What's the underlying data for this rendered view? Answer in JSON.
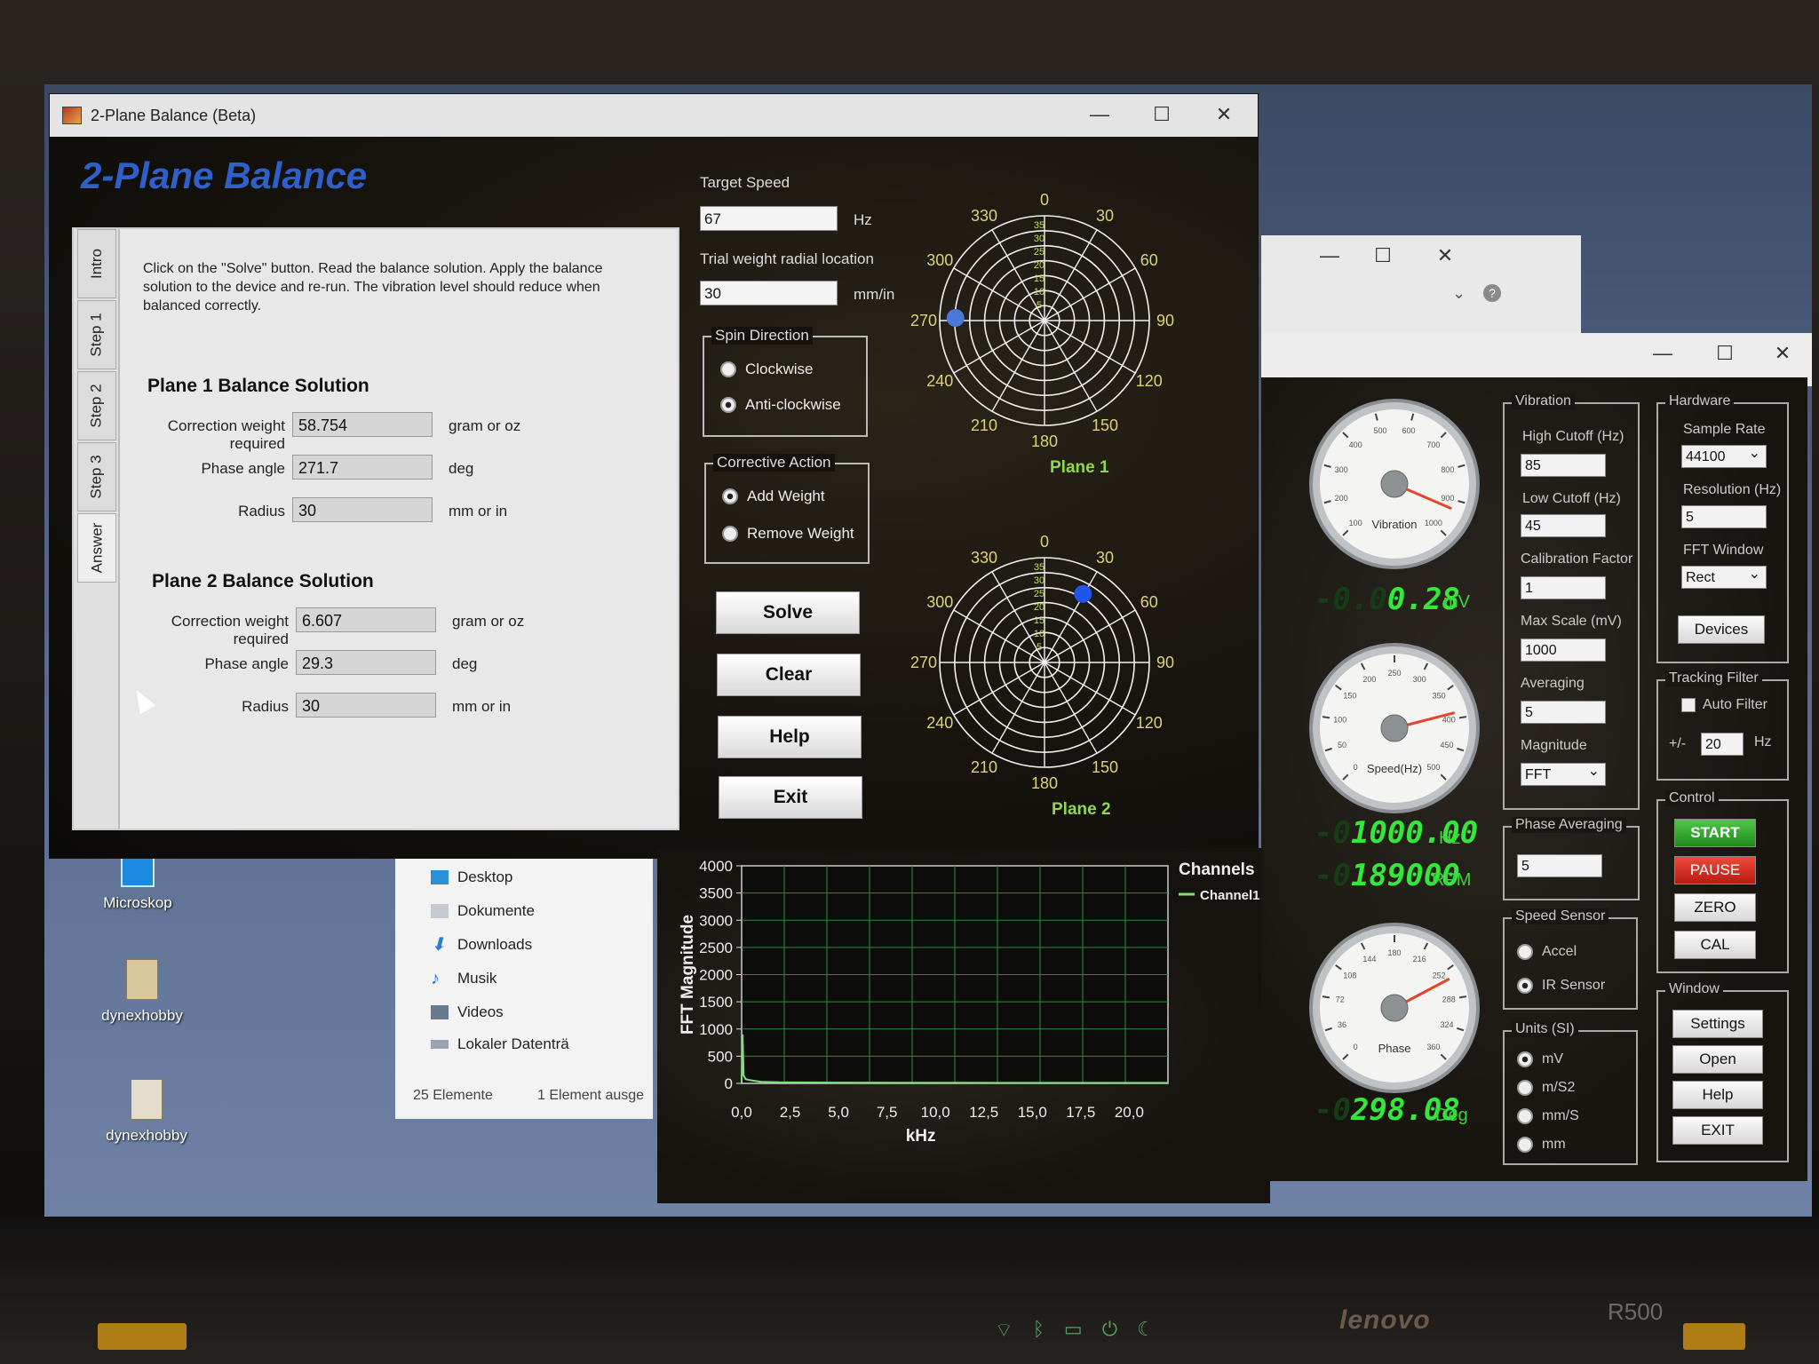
{
  "laptop": {
    "brand": "lenovo",
    "model": "R500"
  },
  "desktop": {
    "icons": [
      "Microskop",
      "dynexhobby",
      "dynexhobby"
    ],
    "explorer": {
      "items": [
        "Desktop",
        "Dokumente",
        "Downloads",
        "Musik",
        "Videos",
        "Lokaler Datenträ"
      ],
      "status_count": "25 Elemente",
      "status_selected": "1 Element ausge"
    }
  },
  "window": {
    "title": "2-Plane Balance (Beta)",
    "app_heading": "2-Plane Balance",
    "controls": [
      "—",
      "☐",
      "✕"
    ]
  },
  "wizard": {
    "tabs": [
      "Intro",
      "Step 1",
      "Step 2",
      "Step 3",
      "Answer"
    ],
    "instructions": "Click on the \"Solve\" button. Read the balance solution. Apply the balance solution to the device and re-run. The vibration level should reduce when balanced correctly.",
    "plane1": {
      "title": "Plane 1 Balance Solution",
      "weight_label": "Correction weight required",
      "weight": "58.754",
      "weight_unit": "gram or oz",
      "phase_label": "Phase angle",
      "phase": "271.7",
      "phase_unit": "deg",
      "radius_label": "Radius",
      "radius": "30",
      "radius_unit": "mm or in"
    },
    "plane2": {
      "title": "Plane 2 Balance Solution",
      "weight_label": "Correction weight required",
      "weight": "6.607",
      "weight_unit": "gram or oz",
      "phase_label": "Phase angle",
      "phase": "29.3",
      "phase_unit": "deg",
      "radius_label": "Radius",
      "radius": "30",
      "radius_unit": "mm or in"
    }
  },
  "controls": {
    "target_speed_label": "Target Speed",
    "target_speed": "67",
    "target_speed_unit": "Hz",
    "trial_label": "Trial weight radial location",
    "trial": "30",
    "trial_unit": "mm/in",
    "spin_title": "Spin Direction",
    "spin_options": [
      "Clockwise",
      "Anti-clockwise"
    ],
    "spin_selected": 1,
    "action_title": "Corrective Action",
    "action_options": [
      "Add Weight",
      "Remove Weight"
    ],
    "action_selected": 0,
    "buttons": [
      "Solve",
      "Clear",
      "Help",
      "Exit"
    ]
  },
  "polar_plots": [
    {
      "name": "Plane 1",
      "point_angle_deg": 271.7,
      "point_radius_frac": 0.85,
      "color": "#4a78d8"
    },
    {
      "name": "Plane 2",
      "point_angle_deg": 29.3,
      "point_radius_frac": 0.75,
      "color": "#1f56e8"
    }
  ],
  "polar_angle_labels": [
    "0",
    "30",
    "60",
    "90",
    "120",
    "150",
    "180",
    "210",
    "240",
    "270",
    "300",
    "330"
  ],
  "polar_radial_labels": [
    "35",
    "30",
    "25",
    "20",
    "15",
    "10",
    "5"
  ],
  "chart_data": {
    "type": "line",
    "ylabel": "FFT Magnitude",
    "xlabel": "kHz",
    "ylim": [
      0,
      4000
    ],
    "xlim": [
      0,
      22
    ],
    "y_ticks": [
      "4000",
      "3500",
      "3000",
      "2500",
      "2000",
      "1500",
      "1000",
      "500",
      "0"
    ],
    "x_ticks": [
      "0,0",
      "2,5",
      "5,0",
      "7,5",
      "10,0",
      "12,5",
      "15,0",
      "17,5",
      "20,0"
    ],
    "legend_title": "Channels",
    "series": [
      {
        "name": "Channel1",
        "color": "#7fe07a",
        "x": [
          0,
          0.05,
          0.1,
          0.2,
          0.4,
          1,
          2,
          5,
          10,
          15,
          20,
          22
        ],
        "y": [
          0,
          900,
          150,
          80,
          60,
          30,
          20,
          15,
          12,
          10,
          10,
          10
        ]
      }
    ]
  },
  "gauges": [
    {
      "name": "Vibration",
      "ticks": [
        "100",
        "200",
        "300",
        "400",
        "500",
        "600",
        "700",
        "800",
        "900",
        "1000"
      ],
      "needle_frac": 0.92
    },
    {
      "name": "Speed(Hz)",
      "ticks": [
        "0",
        "50",
        "100",
        "150",
        "200",
        "250",
        "300",
        "350",
        "400",
        "450",
        "500"
      ],
      "needle_frac": 0.78
    },
    {
      "name": "Phase",
      "ticks": [
        "0",
        "36",
        "72",
        "108",
        "144",
        "180",
        "216",
        "252",
        "288",
        "324",
        "360"
      ],
      "needle_frac": 0.73
    }
  ],
  "readouts": {
    "vibration": {
      "ghost": "-0.0",
      "value": "0.28",
      "unit": "mV"
    },
    "speed_hz": {
      "ghost": "-0",
      "value": "1000.00",
      "unit": "Hz"
    },
    "rpm": {
      "ghost": "-0",
      "value": "189000",
      "unit": "RPM"
    },
    "phase": {
      "ghost": "-0",
      "value": "298.08",
      "unit": "Deg"
    }
  },
  "panel": {
    "vibration": {
      "title": "Vibration",
      "high_cutoff_label": "High Cutoff (Hz)",
      "high_cutoff": "85",
      "low_cutoff_label": "Low Cutoff (Hz)",
      "low_cutoff": "45",
      "calibration_label": "Calibration Factor",
      "calibration": "1",
      "max_scale_label": "Max Scale (mV)",
      "max_scale": "1000",
      "averaging_label": "Averaging",
      "averaging": "5",
      "magnitude_label": "Magnitude",
      "magnitude": "FFT"
    },
    "phase_avg_title": "Phase Averaging",
    "phase_avg": "5",
    "speed_sensor_title": "Speed Sensor",
    "speed_sensor_options": [
      "Accel",
      "IR Sensor"
    ],
    "speed_sensor_selected": 1,
    "units_title": "Units (SI)",
    "units_options": [
      "mV",
      "m/S2",
      "mm/S",
      "mm"
    ],
    "units_selected": 0,
    "hardware": {
      "title": "Hardware",
      "sample_rate_label": "Sample Rate",
      "sample_rate": "44100",
      "resolution_label": "Resolution (Hz)",
      "resolution": "5",
      "fft_window_label": "FFT Window",
      "fft_window": "Rect",
      "devices": "Devices"
    },
    "tracking": {
      "title": "Tracking Filter",
      "auto_filter": "Auto Filter",
      "plusminus": "+/-",
      "value": "20",
      "unit": "Hz"
    },
    "control": {
      "title": "Control",
      "start": "START",
      "pause": "PAUSE",
      "zero": "ZERO",
      "cal": "CAL"
    },
    "windowgrp": {
      "title": "Window",
      "settings": "Settings",
      "open": "Open",
      "help": "Help",
      "exit": "EXIT"
    }
  },
  "colors": {
    "heading_blue": "#2f5fc8",
    "plane_label_green": "#8fd84a",
    "led_green": "#33e83a",
    "start_green": "#2fb02a",
    "pause_red": "#d8281e"
  }
}
